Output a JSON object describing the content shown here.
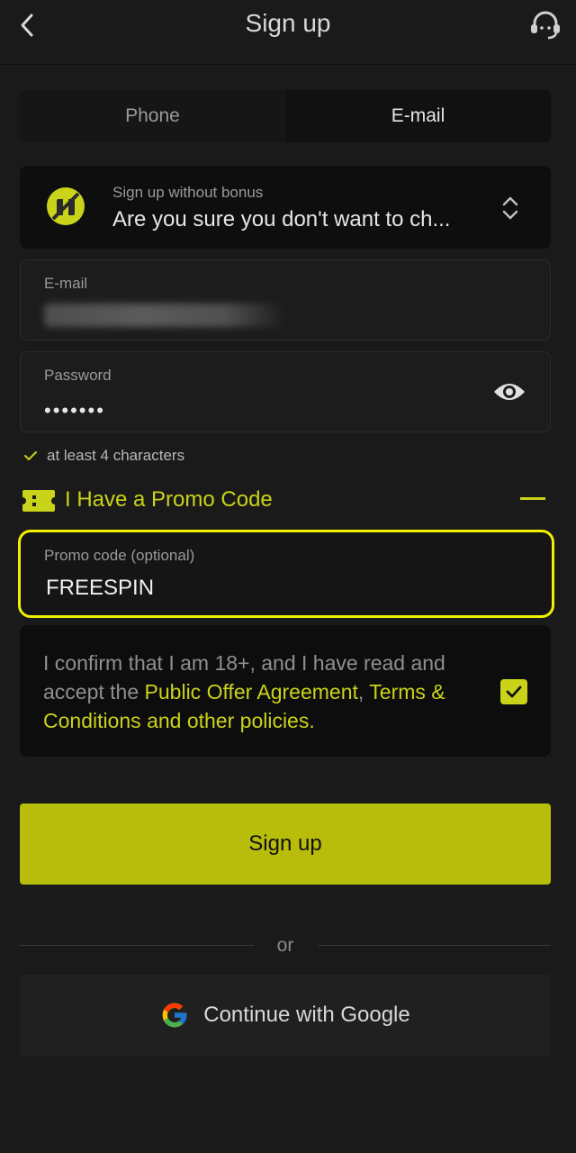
{
  "header": {
    "title": "Sign up",
    "back_icon": "chevron-left-icon",
    "support_icon": "headset-support-icon"
  },
  "tabs": [
    {
      "label": "Phone",
      "active": false
    },
    {
      "label": "E-mail",
      "active": true
    }
  ],
  "bonus_select": {
    "label": "Sign up without bonus",
    "value": "Are you sure you don't want to ch...",
    "icon": "no-bonus-icon",
    "chevron_icon": "chevron-up-down-icon"
  },
  "email_field": {
    "label": "E-mail",
    "value_obscured": true
  },
  "password_field": {
    "label": "Password",
    "value": "•••••••",
    "eye_icon": "eye-icon"
  },
  "password_hint": {
    "text": "at least 4 characters",
    "icon": "checkmark-icon"
  },
  "promo_toggle": {
    "label": "I Have a Promo Code",
    "icon": "ticket-icon",
    "collapse_icon": "minus-icon"
  },
  "promo_field": {
    "label": "Promo code (optional)",
    "value": "FREESPIN"
  },
  "consent": {
    "text_before": "I confirm that I am 18+, and I have read and accept the ",
    "link1": "Public Offer Agreement",
    "comma": ",",
    "link2": "Terms & Conditions and other policies",
    "period": ".",
    "checked": true
  },
  "signup_button": {
    "label": "Sign up"
  },
  "divider": {
    "text": "or"
  },
  "google_button": {
    "label": "Continue with Google",
    "icon": "google-icon"
  },
  "colors": {
    "background": "#1a1a1a",
    "accent": "#c9d31a",
    "button": "#b8bc0a",
    "highlight_border": "#f0f000"
  }
}
